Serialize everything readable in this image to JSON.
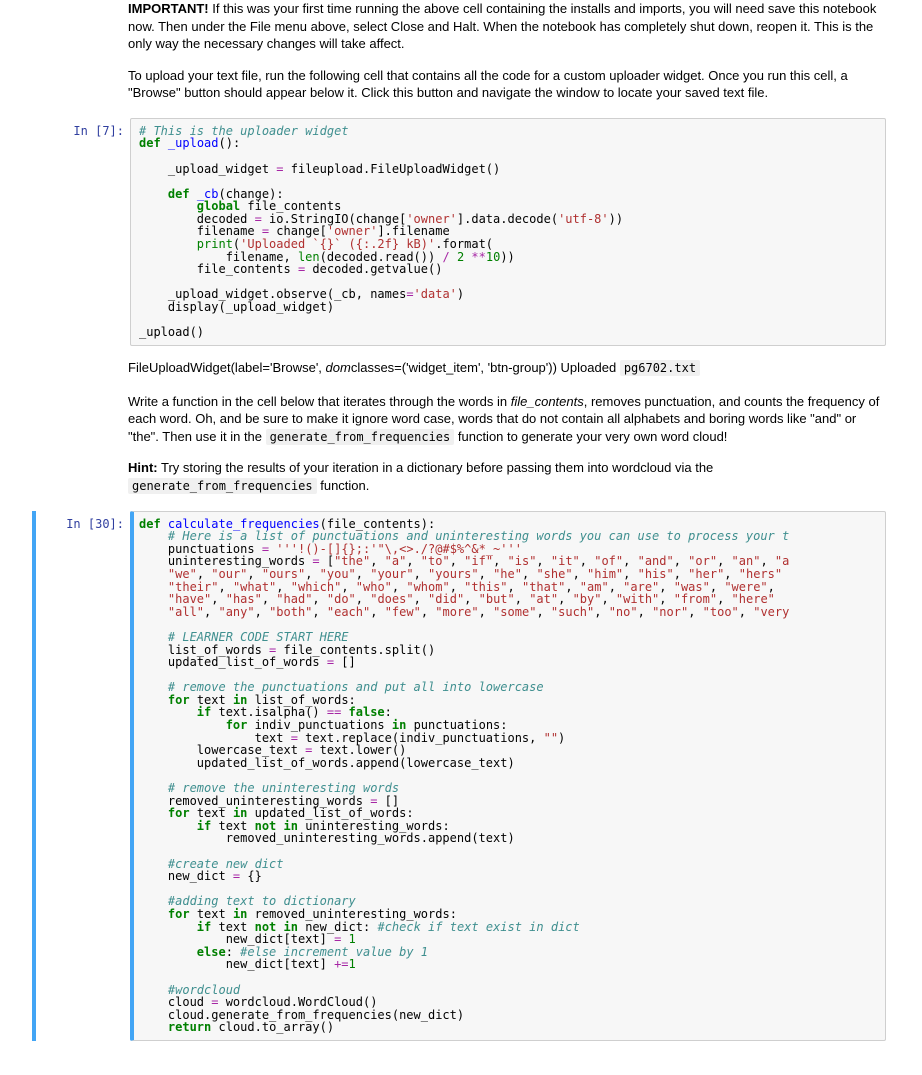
{
  "md1": {
    "p1_strong": "IMPORTANT!",
    "p1_rest": " If this was your first time running the above cell containing the installs and imports, you will need save this notebook now. Then under the File menu above, select Close and Halt. When the notebook has completely shut down, reopen it. This is the only way the necessary changes will take affect.",
    "p2": "To upload your text file, run the following cell that contains all the code for a custom uploader widget. Once you run this cell, a \"Browse\" button should appear below it. Click this button and navigate the window to locate your saved text file."
  },
  "cell1": {
    "prompt": "In [7]:"
  },
  "output1": {
    "text_lead": "FileUploadWidget(label='Browse', ",
    "dom_em": "dom",
    "text_mid": "classes=('widget_item', 'btn-group')) Uploaded ",
    "filename": "pg6702.txt"
  },
  "md2": {
    "p1_a": "Write a function in the cell below that iterates through the words in ",
    "p1_em": "file_contents",
    "p1_b": ", removes punctuation, and counts the frequency of each word. Oh, and be sure to make it ignore word case, words that do not contain all alphabets and boring words like \"and\" or \"the\". Then use it in the ",
    "p1_code": "generate_from_frequencies",
    "p1_c": " function to generate your very own word cloud!",
    "p2_strong": "Hint:",
    "p2_a": " Try storing the results of your iteration in a dictionary before passing them into wordcloud via the ",
    "p2_code": "generate_from_frequencies",
    "p2_b": " function."
  },
  "cell2": {
    "prompt": "In [30]:"
  },
  "chart_data": null
}
